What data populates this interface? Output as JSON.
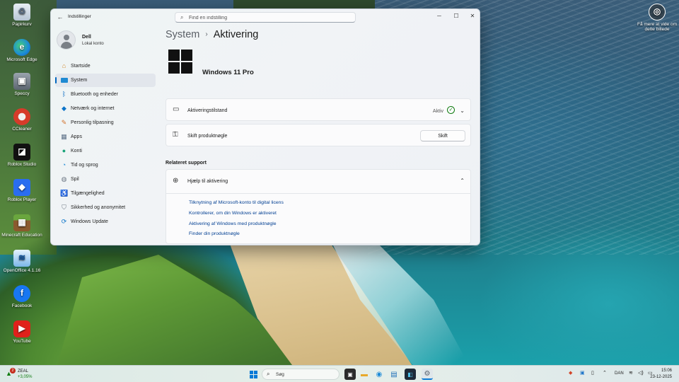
{
  "desktop": {
    "icons": [
      {
        "label": "Papirkurv",
        "icon": "recycle-bin-icon"
      },
      {
        "label": "Microsoft Edge",
        "icon": "edge-icon"
      },
      {
        "label": "Speccy",
        "icon": "speccy-icon"
      },
      {
        "label": "CCleaner",
        "icon": "ccleaner-icon"
      },
      {
        "label": "Roblox Studio",
        "icon": "roblox-studio-icon"
      },
      {
        "label": "Roblox Player",
        "icon": "roblox-player-icon"
      },
      {
        "label": "Minecraft Education",
        "icon": "minecraft-icon"
      },
      {
        "label": "OpenOffice 4.1.16",
        "icon": "openoffice-icon"
      },
      {
        "label": "Facebook",
        "icon": "facebook-icon"
      },
      {
        "label": "YouTube",
        "icon": "youtube-icon"
      }
    ],
    "learn_more": {
      "line1": "Få mere at vide om",
      "line2": "dette billede"
    }
  },
  "window": {
    "app_title": "Indstillinger",
    "search_placeholder": "Find en indstilling",
    "controls": {
      "minimize": "─",
      "maximize": "☐",
      "close": "✕"
    },
    "profile": {
      "name": "Dell",
      "account_type": "Lokal konto"
    },
    "nav": [
      {
        "label": "Startside",
        "icon": "home-icon",
        "selected": false
      },
      {
        "label": "System",
        "icon": "display-icon",
        "selected": true
      },
      {
        "label": "Bluetooth og enheder",
        "icon": "bluetooth-icon",
        "selected": false
      },
      {
        "label": "Netværk og internet",
        "icon": "wifi-icon",
        "selected": false
      },
      {
        "label": "Personlig tilpasning",
        "icon": "brush-icon",
        "selected": false
      },
      {
        "label": "Apps",
        "icon": "apps-icon",
        "selected": false
      },
      {
        "label": "Konti",
        "icon": "person-icon",
        "selected": false
      },
      {
        "label": "Tid og sprog",
        "icon": "globe-clock-icon",
        "selected": false
      },
      {
        "label": "Spil",
        "icon": "gamepad-icon",
        "selected": false
      },
      {
        "label": "Tilgængelighed",
        "icon": "accessibility-icon",
        "selected": false
      },
      {
        "label": "Sikkerhed og anonymitet",
        "icon": "shield-icon",
        "selected": false
      },
      {
        "label": "Windows Update",
        "icon": "update-icon",
        "selected": false
      }
    ],
    "breadcrumb": {
      "parent": "System",
      "separator": "›",
      "current": "Aktivering"
    },
    "edition": "Windows 11 Pro",
    "activation_state": {
      "label": "Aktiveringstilstand",
      "status": "Aktiv"
    },
    "product_key": {
      "label": "Skift produktnøgle",
      "button": "Skift"
    },
    "related": {
      "title": "Relateret support",
      "help_label": "Hjælp til aktivering",
      "links": [
        "Tilknytning af Microsoft-konto til digital licens",
        "Kontrollerer, om din Windows er aktiveret",
        "Aktivering af Windows med produktnøgle",
        "Finder din produktnøgle"
      ]
    }
  },
  "taskbar": {
    "weather": {
      "badge": "2",
      "name": "ZEAL",
      "value": "+3,05%"
    },
    "search_label": "Søg",
    "language": "DAN",
    "time": "15:06",
    "date": "23-12-2025"
  },
  "colors": {
    "accent": "#0067c0",
    "link": "#003e92",
    "success": "#0f7b0f"
  }
}
